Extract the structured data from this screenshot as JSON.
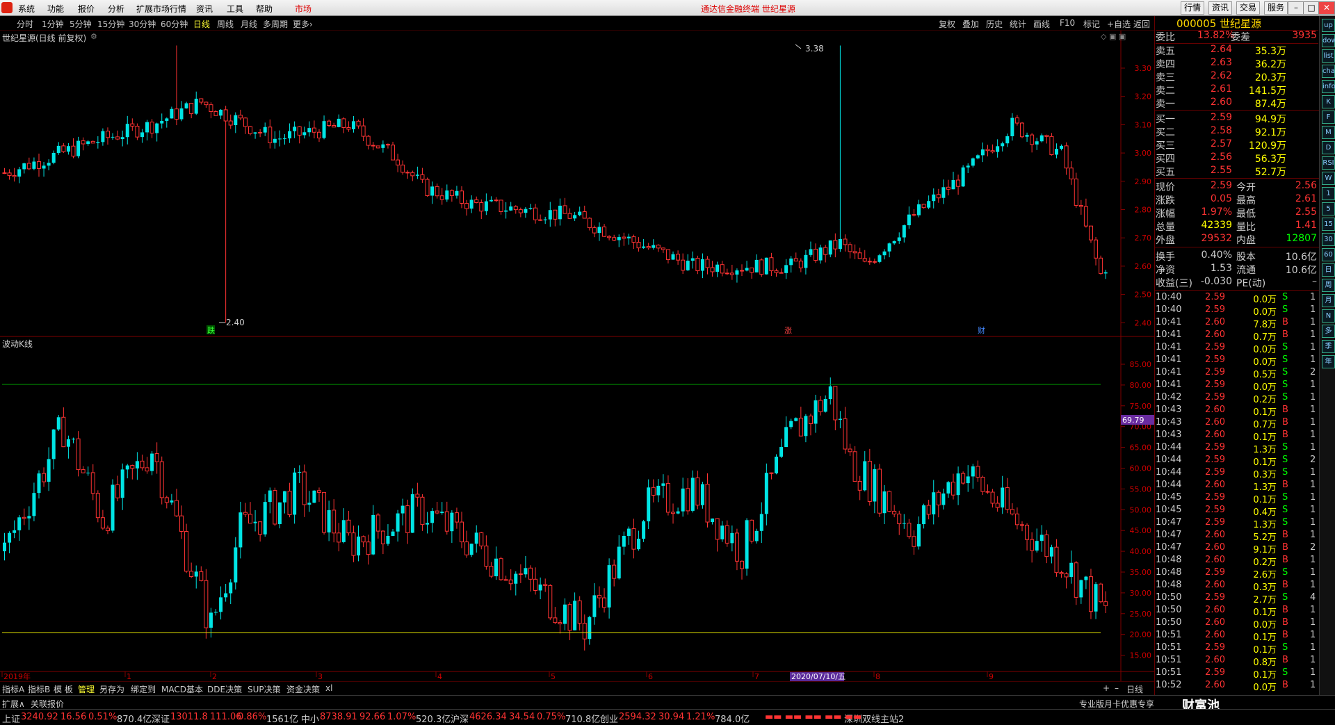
{
  "app": {
    "menus": [
      "系统",
      "功能",
      "报价",
      "分析",
      "扩展市场行情",
      "资讯",
      "工具",
      "帮助",
      "市场"
    ],
    "title": "通达信金融终端  世纪星源",
    "right_buttons": [
      "行情",
      "资讯",
      "交易",
      "服务"
    ],
    "window_buttons": [
      "–",
      "□",
      "✕"
    ]
  },
  "toolbar": {
    "periods": [
      "分时",
      "1分钟",
      "5分钟",
      "15分钟",
      "30分钟",
      "60分钟",
      "日线",
      "周线",
      "月线",
      "多周期",
      "更多›"
    ],
    "selected": "日线",
    "right_tools": [
      "复权",
      "叠加",
      "历史",
      "统计",
      "画线",
      "F10",
      "标记",
      "+自选",
      "返回"
    ]
  },
  "main_chart": {
    "title": "世纪星源(日线 前复权)",
    "y_ticks": [
      "3.30",
      "3.20",
      "3.10",
      "3.00",
      "2.90",
      "2.80",
      "2.70",
      "2.60",
      "2.50",
      "2.40"
    ],
    "high_label": "3.38",
    "low_label": "2.40",
    "markers": [
      "跌",
      "涨",
      "财"
    ]
  },
  "indicator": {
    "title": "波动K线",
    "y_ticks": [
      "85.00",
      "80.00",
      "75.00",
      "70.00",
      "65.00",
      "60.00",
      "55.00",
      "50.00",
      "45.00",
      "40.00",
      "35.00",
      "30.00",
      "25.00",
      "20.00",
      "15.00"
    ],
    "current": "69.79",
    "upper_line": 80,
    "lower_line": 20
  },
  "time_axis": {
    "labels": [
      "2019年",
      "1",
      "2",
      "3",
      "4",
      "5",
      "6",
      "7",
      "8",
      "9"
    ],
    "highlight": "2020/07/10/五",
    "period_label": "日线"
  },
  "tabs": [
    "指标A",
    "指标B",
    "模 板",
    "管理",
    "另存为",
    "绑定到",
    "MACD基本",
    "DDE决策",
    "SUP决策",
    "资金决策",
    "xl"
  ],
  "tab_selected": "管理",
  "status_bar": {
    "left": [
      "扩展∧",
      "关联报价"
    ],
    "right": "专业版月卡优惠专享",
    "stats": [
      {
        "name": "上证",
        "price": "3240.92",
        "chg": "16.56",
        "pct": "0.51%",
        "amt": "870.4亿"
      },
      {
        "name": "深证",
        "price": "13011.8",
        "chg": "111.06",
        "pct": "0.86%",
        "amt": "1561亿"
      },
      {
        "name": "中小",
        "price": "8738.91",
        "chg": "92.66",
        "pct": "1.07%",
        "amt": "520.3亿"
      },
      {
        "name": "沪深",
        "price": "4626.34",
        "chg": "34.54",
        "pct": "0.75%",
        "amt": "710.8亿"
      },
      {
        "name": "创业",
        "price": "2594.32",
        "chg": "30.94",
        "pct": "1.21%",
        "amt": "784.0亿"
      }
    ],
    "server": "深圳双线主站2"
  },
  "quote": {
    "code_name": "000005 世纪星源",
    "weibi_label": "委比",
    "weibi": "13.82%",
    "weicha_label": "委差",
    "weicha": "3935",
    "sell": [
      {
        "label": "卖五",
        "price": "2.64",
        "vol": "35.3万"
      },
      {
        "label": "卖四",
        "price": "2.63",
        "vol": "36.2万"
      },
      {
        "label": "卖三",
        "price": "2.62",
        "vol": "20.3万"
      },
      {
        "label": "卖二",
        "price": "2.61",
        "vol": "141.5万"
      },
      {
        "label": "卖一",
        "price": "2.60",
        "vol": "87.4万"
      }
    ],
    "buy": [
      {
        "label": "买一",
        "price": "2.59",
        "vol": "94.9万"
      },
      {
        "label": "买二",
        "price": "2.58",
        "vol": "92.1万"
      },
      {
        "label": "买三",
        "price": "2.57",
        "vol": "120.9万"
      },
      {
        "label": "买四",
        "price": "2.56",
        "vol": "56.3万"
      },
      {
        "label": "买五",
        "price": "2.55",
        "vol": "52.7万"
      }
    ],
    "stats": [
      {
        "l1": "现价",
        "v1": "2.59",
        "l2": "今开",
        "v2": "2.56"
      },
      {
        "l1": "涨跌",
        "v1": "0.05",
        "l2": "最高",
        "v2": "2.61"
      },
      {
        "l1": "涨幅",
        "v1": "1.97%",
        "l2": "最低",
        "v2": "2.55"
      },
      {
        "l1": "总量",
        "v1": "42339",
        "l2": "量比",
        "v2": "1.41"
      },
      {
        "l1": "外盘",
        "v1": "29532",
        "l2": "内盘",
        "v2": "12807"
      }
    ],
    "stats2": [
      {
        "l1": "换手",
        "v1": "0.40%",
        "l2": "股本",
        "v2": "10.6亿"
      },
      {
        "l1": "净资",
        "v1": "1.53",
        "l2": "流通",
        "v2": "10.6亿"
      },
      {
        "l1": "收益(三)",
        "v1": "-0.030",
        "l2": "PE(动)",
        "v2": "–"
      }
    ],
    "ticks": [
      {
        "t": "10:40",
        "p": "2.59",
        "v": "0.0万",
        "bs": "S",
        "n": "1"
      },
      {
        "t": "10:40",
        "p": "2.59",
        "v": "0.0万",
        "bs": "S",
        "n": "1"
      },
      {
        "t": "10:41",
        "p": "2.60",
        "v": "7.8万",
        "bs": "B",
        "n": "1"
      },
      {
        "t": "10:41",
        "p": "2.60",
        "v": "0.7万",
        "bs": "B",
        "n": "1"
      },
      {
        "t": "10:41",
        "p": "2.59",
        "v": "0.0万",
        "bs": "S",
        "n": "1"
      },
      {
        "t": "10:41",
        "p": "2.59",
        "v": "0.0万",
        "bs": "S",
        "n": "1"
      },
      {
        "t": "10:41",
        "p": "2.59",
        "v": "0.5万",
        "bs": "S",
        "n": "2"
      },
      {
        "t": "10:41",
        "p": "2.59",
        "v": "0.0万",
        "bs": "S",
        "n": "1"
      },
      {
        "t": "10:42",
        "p": "2.59",
        "v": "0.2万",
        "bs": "S",
        "n": "1"
      },
      {
        "t": "10:43",
        "p": "2.60",
        "v": "0.1万",
        "bs": "B",
        "n": "1"
      },
      {
        "t": "10:43",
        "p": "2.60",
        "v": "0.7万",
        "bs": "B",
        "n": "1"
      },
      {
        "t": "10:43",
        "p": "2.60",
        "v": "0.1万",
        "bs": "B",
        "n": "1"
      },
      {
        "t": "10:44",
        "p": "2.59",
        "v": "1.3万",
        "bs": "S",
        "n": "1"
      },
      {
        "t": "10:44",
        "p": "2.59",
        "v": "0.1万",
        "bs": "S",
        "n": "2"
      },
      {
        "t": "10:44",
        "p": "2.59",
        "v": "0.3万",
        "bs": "S",
        "n": "1"
      },
      {
        "t": "10:44",
        "p": "2.60",
        "v": "1.3万",
        "bs": "B",
        "n": "1"
      },
      {
        "t": "10:45",
        "p": "2.59",
        "v": "0.1万",
        "bs": "S",
        "n": "1"
      },
      {
        "t": "10:45",
        "p": "2.59",
        "v": "0.4万",
        "bs": "S",
        "n": "1"
      },
      {
        "t": "10:47",
        "p": "2.59",
        "v": "1.3万",
        "bs": "S",
        "n": "1"
      },
      {
        "t": "10:47",
        "p": "2.60",
        "v": "5.2万",
        "bs": "B",
        "n": "1"
      },
      {
        "t": "10:47",
        "p": "2.60",
        "v": "9.1万",
        "bs": "B",
        "n": "2"
      },
      {
        "t": "10:48",
        "p": "2.60",
        "v": "0.2万",
        "bs": "B",
        "n": "1"
      },
      {
        "t": "10:48",
        "p": "2.59",
        "v": "2.6万",
        "bs": "S",
        "n": "1"
      },
      {
        "t": "10:48",
        "p": "2.60",
        "v": "0.3万",
        "bs": "B",
        "n": "1"
      },
      {
        "t": "10:50",
        "p": "2.59",
        "v": "2.7万",
        "bs": "S",
        "n": "4"
      },
      {
        "t": "10:50",
        "p": "2.60",
        "v": "0.1万",
        "bs": "B",
        "n": "1"
      },
      {
        "t": "10:50",
        "p": "2.60",
        "v": "0.0万",
        "bs": "B",
        "n": "1"
      },
      {
        "t": "10:51",
        "p": "2.60",
        "v": "0.1万",
        "bs": "B",
        "n": "1"
      },
      {
        "t": "10:51",
        "p": "2.59",
        "v": "0.1万",
        "bs": "S",
        "n": "1"
      },
      {
        "t": "10:51",
        "p": "2.60",
        "v": "0.8万",
        "bs": "B",
        "n": "1"
      },
      {
        "t": "10:51",
        "p": "2.59",
        "v": "0.1万",
        "bs": "S",
        "n": "1"
      },
      {
        "t": "10:52",
        "p": "2.60",
        "v": "0.0万",
        "bs": "B",
        "n": "1"
      }
    ]
  },
  "side_icons": [
    "up",
    "down",
    "list",
    "chart",
    "info",
    "K",
    "F",
    "M",
    "D",
    "RSI",
    "W",
    "1",
    "5",
    "15",
    "30",
    "60",
    "日",
    "周",
    "月",
    "N",
    "多",
    "季",
    "年"
  ],
  "colors": {
    "up": "#ff3333",
    "down": "#00e5e5",
    "flat": "#ffffff",
    "axis": "#c00000",
    "green_line": "#00a000",
    "yellow_line": "#e0e000"
  }
}
